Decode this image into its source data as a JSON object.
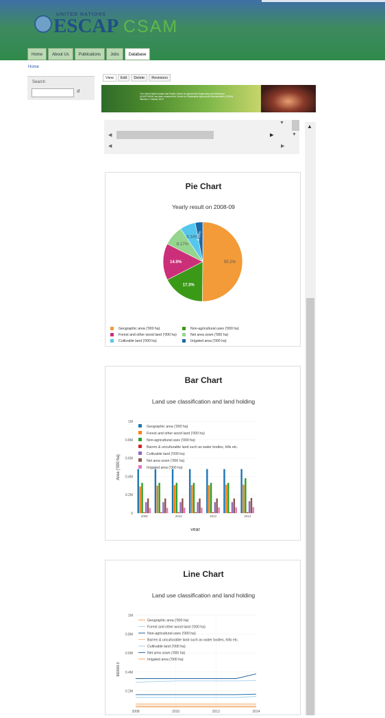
{
  "header": {
    "un_text": "UNITED NATIONS",
    "logo_main": "ESCAP",
    "logo_secondary": "CSAM"
  },
  "nav": {
    "tabs": [
      {
        "label": "Home"
      },
      {
        "label": "About Us"
      },
      {
        "label": "Publications"
      },
      {
        "label": "Jobs"
      },
      {
        "label": "Database",
        "active": true
      }
    ]
  },
  "breadcrumb": "Home",
  "search": {
    "title": "Search",
    "button_icon": "search-icon"
  },
  "content_tabs": [
    "View",
    "Edit",
    "Delete",
    "Revisions"
  ],
  "banner": {
    "text": "The United Nations Asian and Pacific Centre for Agricultural Engineering and Machinery (UNAPCAEM) has been renamed the Centre for Sustainable Agricultural Mechanization (CSAM) effective 1 October 2012"
  },
  "colors": {
    "blue": "#1f77b4",
    "orange": "#ff7f0e",
    "green": "#2ca02c",
    "red": "#d62728",
    "purple": "#9467bd",
    "brown": "#8c564b",
    "pink": "#e377c2",
    "header_green": "#3e8a60",
    "logo_blue": "#1f4f86",
    "csam_green": "#5fb84c"
  },
  "pie": {
    "title": "Pie Chart",
    "subtitle": "Yearly result on 2008-09",
    "chart_data": {
      "type": "pie",
      "labels": [
        "Geographic area ('000 ha)",
        "Non-agricultural uses ('000 ha)",
        "Forest and other wood land ('000 ha)",
        "Net area sown ('000 ha)",
        "Cultivable land ('000 ha)",
        "Irrigated area ('000 ha)"
      ],
      "values": [
        50.2,
        17.3,
        14.9,
        8.17,
        6.34,
        3.09
      ],
      "slice_labels": [
        "50.2%",
        "17.3%",
        "14.9%",
        "8.17%",
        "6.34%",
        "3.09%"
      ],
      "colors": [
        "#f29b38",
        "#3a9a17",
        "#cc2f79",
        "#96d58f",
        "#55c7ef",
        "#1d69a8"
      ]
    }
  },
  "bar": {
    "title": "Bar Chart",
    "subtitle": "Land use classification and land holding",
    "chart_data": {
      "type": "bar",
      "x": [
        2008,
        2009,
        2010,
        2011,
        2012,
        2013,
        2014
      ],
      "x_ticks": [
        "2008",
        "2010",
        "2012",
        "2014"
      ],
      "xlabel": "year",
      "ylabel": "Area ('000 ha)",
      "y_ticks": [
        "0",
        "0.2M",
        "0.4M",
        "0.6M",
        "0.8M",
        "1M"
      ],
      "ylim": [
        0,
        1000000
      ],
      "series": [
        {
          "name": "Geographic area ('000 ha)",
          "color": "#1f77b4",
          "values": [
            480000,
            480000,
            480000,
            480000,
            480000,
            480000,
            480000
          ]
        },
        {
          "name": "Forest and other wood land ('000 ha)",
          "color": "#ff7f0e",
          "values": [
            290000,
            300000,
            305000,
            305000,
            305000,
            310000,
            310000
          ]
        },
        {
          "name": "Non-agricultural uses ('000 ha)",
          "color": "#2ca02c",
          "values": [
            330000,
            330000,
            330000,
            330000,
            330000,
            330000,
            380000
          ]
        },
        {
          "name": "Barren & unculturable land such as water bodies, hills etc.",
          "color": "#d62728",
          "values": [
            10000,
            10000,
            10000,
            10000,
            10000,
            10000,
            10000
          ]
        },
        {
          "name": "Cultivable land ('000 ha)",
          "color": "#9467bd",
          "values": [
            120000,
            120000,
            120000,
            120000,
            120000,
            120000,
            130000
          ]
        },
        {
          "name": "Net area sown ('000 ha)",
          "color": "#8c564b",
          "values": [
            160000,
            160000,
            160000,
            160000,
            160000,
            160000,
            165000
          ]
        },
        {
          "name": "Irrigated area ('000 ha)",
          "color": "#e377c2",
          "values": [
            55000,
            58000,
            60000,
            60000,
            62000,
            63000,
            65000
          ]
        }
      ]
    }
  },
  "line": {
    "title": "Line Chart",
    "subtitle": "Land use classification and land holding",
    "chart_data": {
      "type": "line",
      "x": [
        2008,
        2009,
        2010,
        2011,
        2012,
        2013,
        2014
      ],
      "x_ticks": [
        "2008",
        "2010",
        "2012",
        "2014"
      ],
      "ylabel": "960000.0",
      "y_ticks": [
        "0.2M",
        "0.4M",
        "0.6M",
        "0.8M",
        "1M"
      ],
      "ylim": [
        0,
        1000000
      ],
      "series": [
        {
          "name": "Geographic area ('000 ha)",
          "color": "#f4a15a",
          "values": [
            30000,
            30000,
            30000,
            30000,
            30000,
            30000,
            30000
          ]
        },
        {
          "name": "Forest and other wood land ('000 ha)",
          "color": "#a8d4f0",
          "values": [
            290000,
            300000,
            305000,
            305000,
            305000,
            305000,
            310000
          ]
        },
        {
          "name": "Non-agricultural uses ('000 ha)",
          "color": "#1f5f9a",
          "values": [
            330000,
            330000,
            330000,
            330000,
            330000,
            330000,
            380000
          ]
        },
        {
          "name": "Barren & unculturable land such as water bodies, hills etc.",
          "color": "#f7c08a",
          "values": [
            40000,
            40000,
            40000,
            40000,
            40000,
            40000,
            40000
          ]
        },
        {
          "name": "Cultivable land ('000 ha)",
          "color": "#9fd0ee",
          "values": [
            130000,
            130000,
            130000,
            130000,
            130000,
            130000,
            140000
          ]
        },
        {
          "name": "Net area sown ('000 ha)",
          "color": "#2a6fb0",
          "values": [
            160000,
            160000,
            160000,
            160000,
            160000,
            160000,
            165000
          ]
        },
        {
          "name": "Irrigated area ('000 ha)",
          "color": "#f5a35a",
          "values": [
            60000,
            60000,
            60000,
            60000,
            60000,
            60000,
            60000
          ]
        }
      ]
    }
  }
}
